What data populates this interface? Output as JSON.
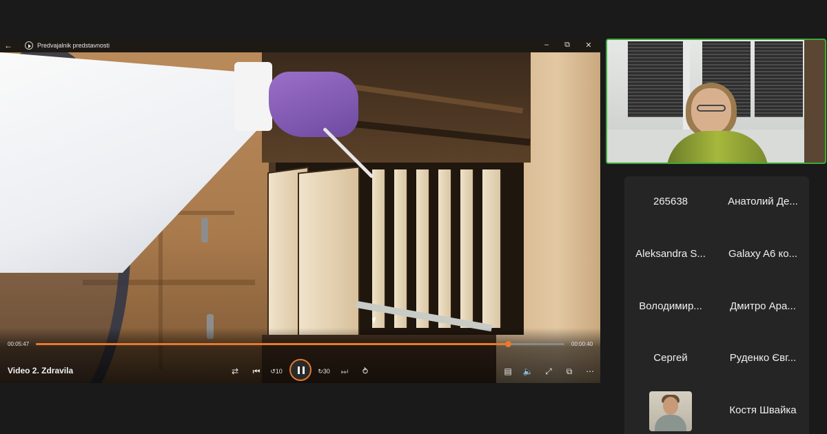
{
  "player": {
    "window_title": "Predvajalnik predstavnosti",
    "video_title": "Video 2. Zdravila",
    "elapsed": "00:05:47",
    "remaining": "00:00:40",
    "progress_fraction": 0.893,
    "accent_color": "#e87a2c",
    "icons": [
      "back-arrow-icon",
      "app-icon",
      "minimize-icon",
      "restore-icon",
      "close-icon",
      "shuffle-icon",
      "previous-icon",
      "skip-back-10-icon",
      "pause-icon",
      "skip-forward-30-icon",
      "next-icon",
      "repeat-off-icon",
      "subtitles-icon",
      "volume-icon",
      "fullscreen-icon",
      "mini-player-icon",
      "more-icon"
    ]
  },
  "participants": {
    "names": [
      "265638",
      "Анатолий Де...",
      "Aleksandra S...",
      "Galaxy A6 ко...",
      "Володимир...",
      "Дмитро Ара...",
      "Сергей",
      "Руденко Євг...",
      "Костя Швайка"
    ]
  },
  "speaker_highlight_color": "#3fa93a"
}
